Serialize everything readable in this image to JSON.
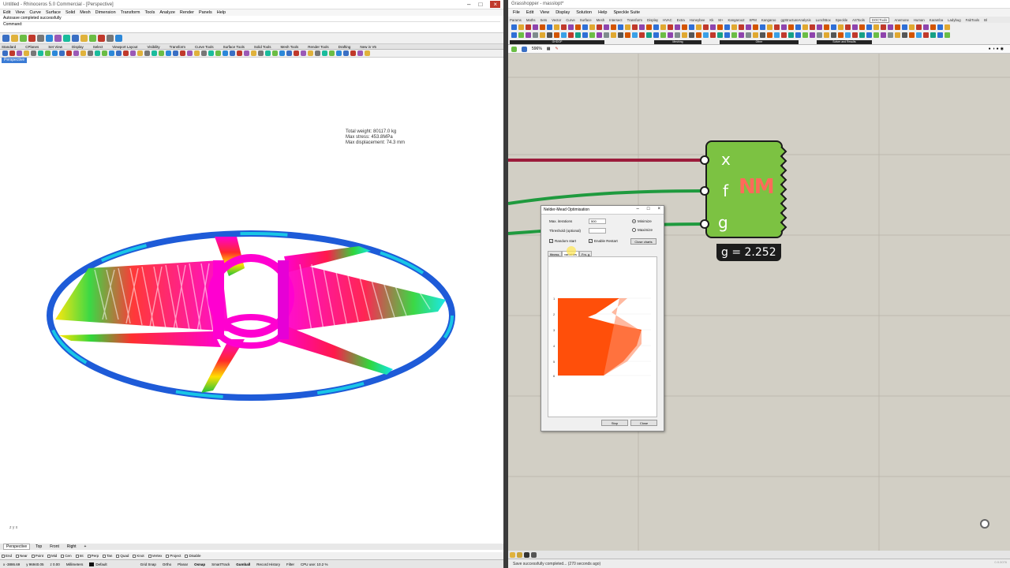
{
  "rhino": {
    "title": "Untitled - Rhinoceros 5.0 Commercial - [Perspective]",
    "menu": [
      "Edit",
      "View",
      "Curve",
      "Surface",
      "Solid",
      "Mesh",
      "Dimension",
      "Transform",
      "Tools",
      "Analyze",
      "Render",
      "Panels",
      "Help"
    ],
    "command_history": [
      "Autosave completed successfully",
      "Command:"
    ],
    "tool_tabs": [
      "Standard",
      "CPlanes",
      "Set View",
      "Display",
      "Select",
      "Viewport Layout",
      "Visibility",
      "Transform",
      "Curve Tools",
      "Surface Tools",
      "Solid Tools",
      "Mesh Tools",
      "Render Tools",
      "Drafting",
      "New in V5"
    ],
    "viewport_label": "Perspective",
    "stats": {
      "weight": "Total weight: 80117.0 kg",
      "stress": "Max stress: 453.8MPa",
      "displacement": "Max displacement: 74.3 mm"
    },
    "axis_label": "z y x",
    "viewport_tabs": [
      "Perspective",
      "Top",
      "Front",
      "Right",
      "+"
    ],
    "osnap": [
      "End",
      "Near",
      "Point",
      "Mid",
      "Cen",
      "Int",
      "Perp",
      "Tan",
      "Quad",
      "Knot",
      "Vertex",
      "Project",
      "Disable"
    ],
    "status": {
      "x": "x -3886.69",
      "y": "y 96940.05",
      "z": "z 0.00",
      "units": "Millimeters",
      "layer": "Default",
      "items": [
        "Grid Snap",
        "Ortho",
        "Planar",
        "Osnap",
        "SmartTrack",
        "Gumball",
        "Record History",
        "Filter",
        "CPU use: 10.2 %"
      ]
    }
  },
  "gh": {
    "title": "Grasshopper - masslopt*",
    "menu": [
      "File",
      "Edit",
      "View",
      "Display",
      "Solution",
      "Help",
      "Speckle Suite"
    ],
    "tabs": [
      "Params",
      "Maths",
      "Sets",
      "Vector",
      "Curve",
      "Surface",
      "Mesh",
      "Intersect",
      "Transform",
      "Display",
      "HVAC",
      "Extra",
      "Honeybee",
      "Kk",
      "M+",
      "Kangaroo2",
      "SPM",
      "Kangaroo",
      "ggStructureAnalysis",
      "LunchBox",
      "Speckle",
      "ASTools",
      "DOCTools",
      "Anemone",
      "Human",
      "Karamba",
      "Ladybug",
      "FabTools",
      "Bl"
    ],
    "active_tab": "DOCTools",
    "ribbon_groups": [
      "GHDOP",
      "Meshing",
      "Other",
      "Solver and Results"
    ],
    "zoom": "596%",
    "component": {
      "inputs": [
        "x",
        "f",
        "g"
      ],
      "logo": "NM",
      "output": "g = 2.252"
    },
    "status": "Save successfully completed... (270 seconds ago)",
    "version": "0.9.0076"
  },
  "dialog": {
    "title": "Nelder-Mead Optimisation",
    "max_iterations_label": "Max. iterations",
    "max_iterations_value": "500",
    "threshold_label": "Threshold (optional)",
    "threshold_value": "",
    "minimize_label": "Minimize",
    "maximize_label": "Maximize",
    "random_start_label": "Random start",
    "enable_restart_label": "Enable Restart",
    "close_charts_label": "Close charts",
    "tabs": [
      "fitness",
      "variables",
      "Fm. g"
    ],
    "active_tab": "variables",
    "stop_label": "Stop",
    "close_label": "Close",
    "plot_ticks": [
      "1",
      "2",
      "3",
      "4",
      "5",
      "6"
    ]
  },
  "colors": {
    "gh_canvas": "#d2cfc5",
    "component_green": "#7cc242",
    "wire_red": "#9c1b3b",
    "wire_green": "#1f9a3e",
    "plot_fill": "#ff4f0a"
  }
}
